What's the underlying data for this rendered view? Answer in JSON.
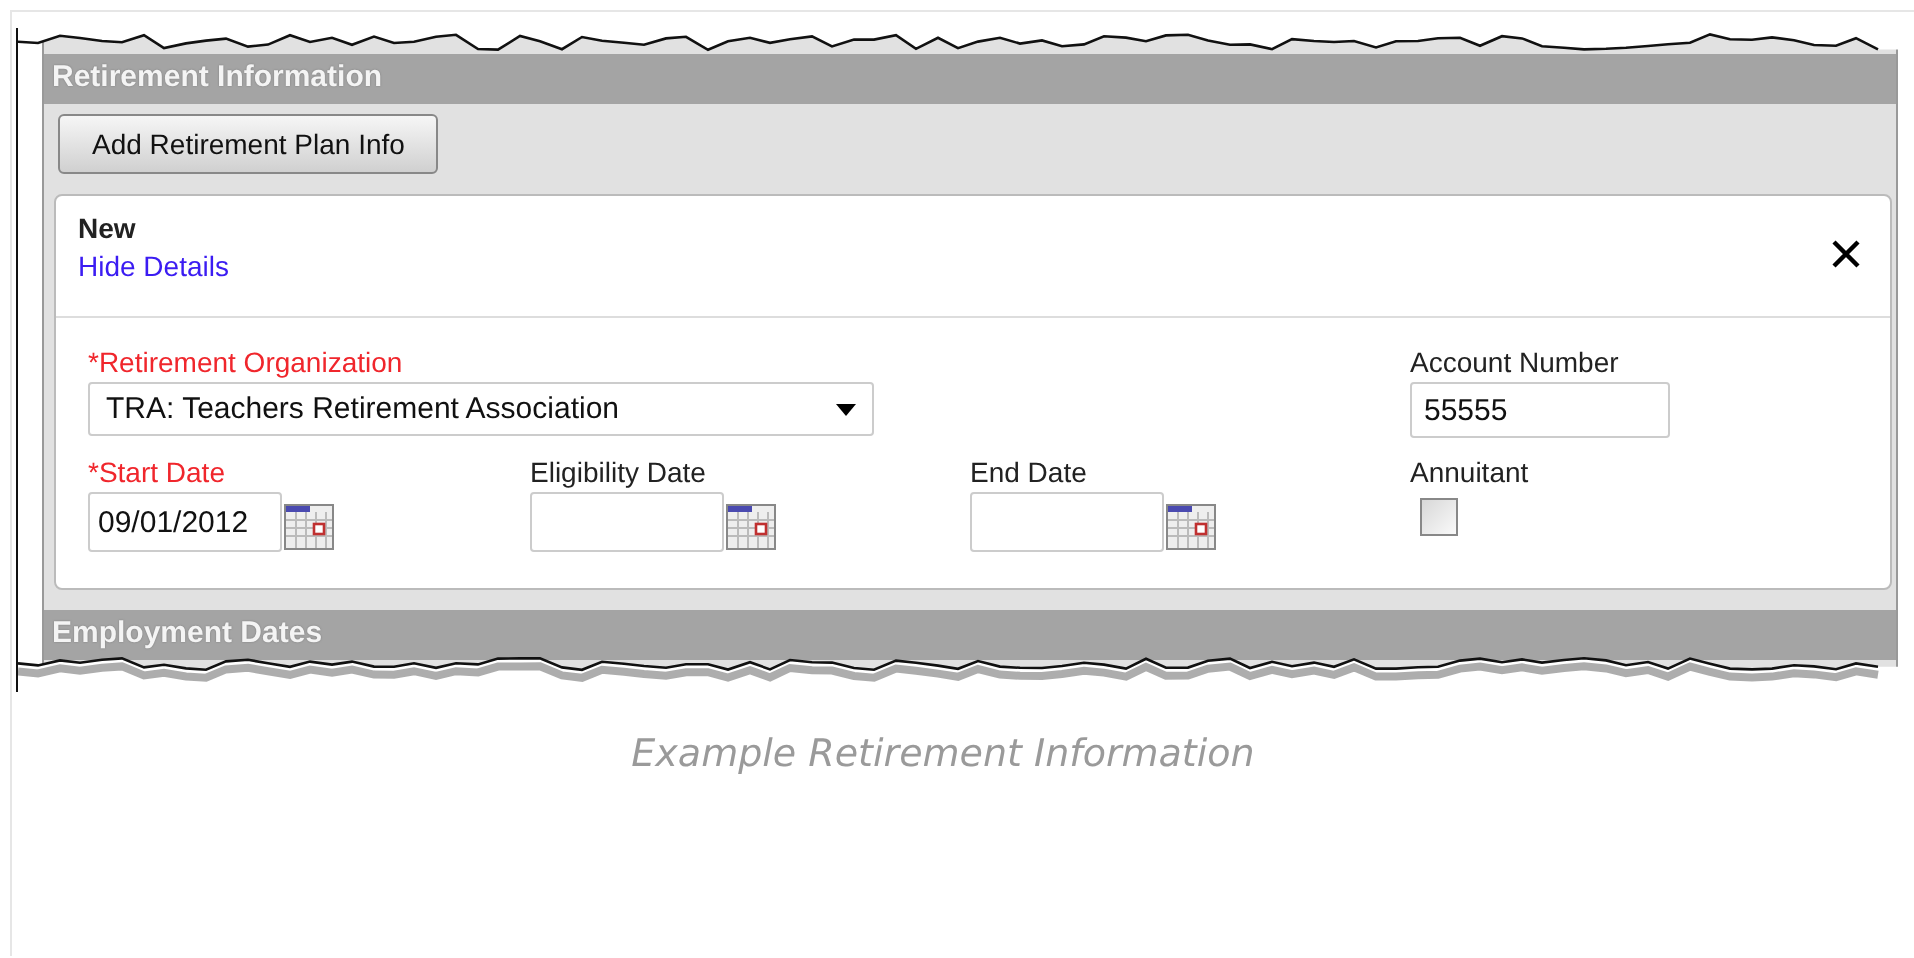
{
  "section": {
    "title": "Retirement Information"
  },
  "add_button": {
    "label": "Add Retirement Plan Info"
  },
  "record": {
    "title": "New",
    "toggle_link": "Hide Details",
    "fields": [
      {
        "kind": "select",
        "label": "*Retirement Organization",
        "required": true,
        "value": "TRA: Teachers Retirement Association"
      },
      {
        "kind": "text",
        "label": "Account Number",
        "required": false,
        "value": "55555"
      },
      {
        "kind": "date",
        "label": "*Start Date",
        "required": true,
        "value": "09/01/2012"
      },
      {
        "kind": "date",
        "label": "Eligibility Date",
        "required": false
      },
      {
        "kind": "date",
        "label": "End Date",
        "required": false
      },
      {
        "kind": "checkbox",
        "label": "Annuitant",
        "required": false,
        "checked": false
      }
    ]
  },
  "next_section": {
    "title": "Employment Dates"
  },
  "caption": "Example Retirement Information"
}
